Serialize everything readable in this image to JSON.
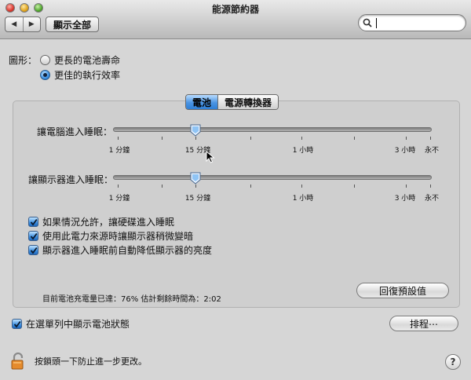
{
  "window": {
    "title": "能源節約器"
  },
  "toolbar": {
    "back_icon": "back-arrow-icon",
    "forward_icon": "forward-arrow-icon",
    "show_all_label": "顯示全部",
    "search_value": ""
  },
  "graphics": {
    "label": "圖形：",
    "options": [
      {
        "label": "更長的電池壽命",
        "selected": false
      },
      {
        "label": "更佳的執行效率",
        "selected": true
      }
    ]
  },
  "tabs": [
    {
      "label": "電池",
      "active": true
    },
    {
      "label": "電源轉換器",
      "active": false
    }
  ],
  "sleep_computer": {
    "label": "讓電腦進入睡眠：",
    "value_label": "15 分鐘",
    "ticks": [
      "1 分鐘",
      "15 分鐘",
      "1 小時",
      "3 小時",
      "永不"
    ]
  },
  "sleep_display": {
    "label": "讓顯示器進入睡眠：",
    "value_label": "15 分鐘",
    "ticks": [
      "1 分鐘",
      "15 分鐘",
      "1 小時",
      "3 小時",
      "永不"
    ]
  },
  "options": [
    {
      "label": "如果情況允許，讓硬碟進入睡眠",
      "checked": true
    },
    {
      "label": "使用此電力來源時讓顯示器稍微變暗",
      "checked": true
    },
    {
      "label": "顯示器進入睡眠前自動降低顯示器的亮度",
      "checked": true
    }
  ],
  "battery_status": "目前電池充電量已達：76%  估計剩餘時間為：2:02",
  "restore_defaults_label": "回復預設值",
  "menu_bar_option": {
    "label": "在選單列中顯示電池狀態",
    "checked": true
  },
  "schedule_label": "排程⋯",
  "lock_text": "按鎖頭一下防止進一步更改。",
  "help_label": "?",
  "colors": {
    "accent": "#3d8fe0",
    "background": "#d6d6d6"
  }
}
